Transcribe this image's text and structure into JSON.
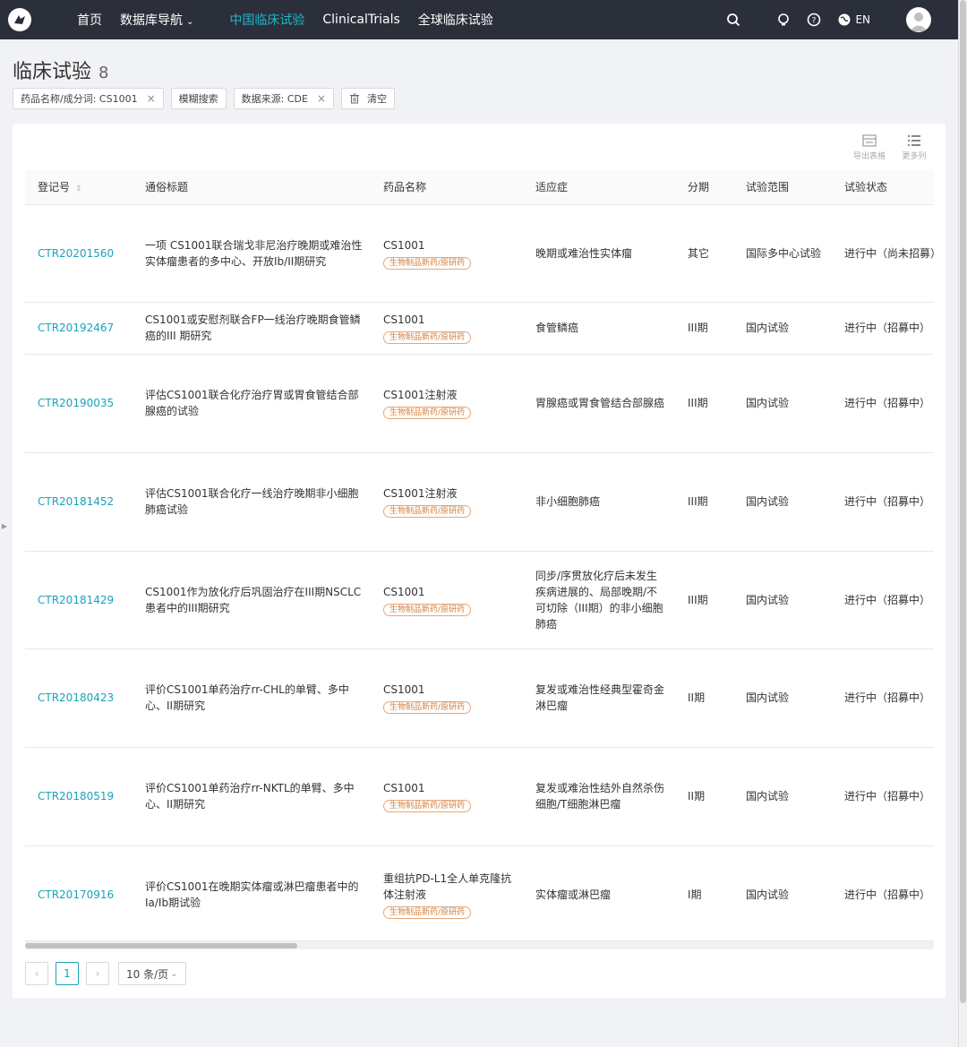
{
  "nav": {
    "items": [
      "首页",
      "数据库导航",
      "中国临床试验",
      "ClinicalTrials",
      "全球临床试验"
    ],
    "lang": "EN",
    "accent": "#1fb6c9",
    "background": "#2b2f3a"
  },
  "page": {
    "title": "临床试验",
    "count": "8"
  },
  "filters": [
    {
      "label": "药品名称/成分词: CS1001",
      "removable": true
    },
    {
      "label": "模糊搜索",
      "removable": false
    },
    {
      "label": "数据来源: CDE",
      "removable": true
    }
  ],
  "clear_label": "清空",
  "tools": {
    "export": "导出表格",
    "more": "更多列"
  },
  "table": {
    "headers": [
      "登记号",
      "通俗标题",
      "药品名称",
      "适应症",
      "分期",
      "试验范围",
      "试验状态"
    ],
    "rows": [
      {
        "id": "CTR20201560",
        "title": "一项 CS1001联合瑞戈非尼治疗晚期或难治性实体瘤患者的多中心、开放Ib/II期研究",
        "drug": "CS1001",
        "badge": "生物制品新药/原研药",
        "indication": "晚期或难治性实体瘤",
        "phase": "其它",
        "scope": "国际多中心试验",
        "status": "进行中（尚未招募）"
      },
      {
        "id": "CTR20192467",
        "title": "CS1001或安慰剂联合FP一线治疗晚期食管鳞癌的III 期研究",
        "drug": "CS1001",
        "badge": "生物制品新药/原研药",
        "indication": "食管鳞癌",
        "phase": "III期",
        "scope": "国内试验",
        "status": "进行中（招募中）"
      },
      {
        "id": "CTR20190035",
        "title": "评估CS1001联合化疗治疗胃或胃食管结合部腺癌的试验",
        "drug": "CS1001注射液",
        "badge": "生物制品新药/原研药",
        "indication": "胃腺癌或胃食管结合部腺癌",
        "phase": "III期",
        "scope": "国内试验",
        "status": "进行中（招募中）"
      },
      {
        "id": "CTR20181452",
        "title": "评估CS1001联合化疗一线治疗晚期非小细胞肺癌试验",
        "drug": "CS1001注射液",
        "badge": "生物制品新药/原研药",
        "indication": "非小细胞肺癌",
        "phase": "III期",
        "scope": "国内试验",
        "status": "进行中（招募中）"
      },
      {
        "id": "CTR20181429",
        "title": "CS1001作为放化疗后巩固治疗在III期NSCLC患者中的III期研究",
        "drug": "CS1001",
        "badge": "生物制品新药/原研药",
        "indication": "同步/序贯放化疗后未发生疾病进展的、局部晚期/不可切除（III期）的非小细胞肺癌",
        "phase": "III期",
        "scope": "国内试验",
        "status": "进行中（招募中）"
      },
      {
        "id": "CTR20180423",
        "title": "评价CS1001单药治疗rr-CHL的单臂、多中心、II期研究",
        "drug": "CS1001",
        "badge": "生物制品新药/原研药",
        "indication": "复发或难治性经典型霍奇金淋巴瘤",
        "phase": "II期",
        "scope": "国内试验",
        "status": "进行中（招募中）"
      },
      {
        "id": "CTR20180519",
        "title": "评价CS1001单药治疗rr-NKTL的单臂、多中心、II期研究",
        "drug": "CS1001",
        "badge": "生物制品新药/原研药",
        "indication": "复发或难治性结外自然杀伤细胞/T细胞淋巴瘤",
        "phase": "II期",
        "scope": "国内试验",
        "status": "进行中（招募中）"
      },
      {
        "id": "CTR20170916",
        "title": "评价CS1001在晚期实体瘤或淋巴瘤患者中的Ia/Ib期试验",
        "drug": "重组抗PD-L1全人单克隆抗体注射液",
        "badge": "生物制品新药/原研药",
        "indication": "实体瘤或淋巴瘤",
        "phase": "I期",
        "scope": "国内试验",
        "status": "进行中（招募中）"
      }
    ]
  },
  "pagination": {
    "current": "1",
    "page_size": "10 条/页"
  }
}
